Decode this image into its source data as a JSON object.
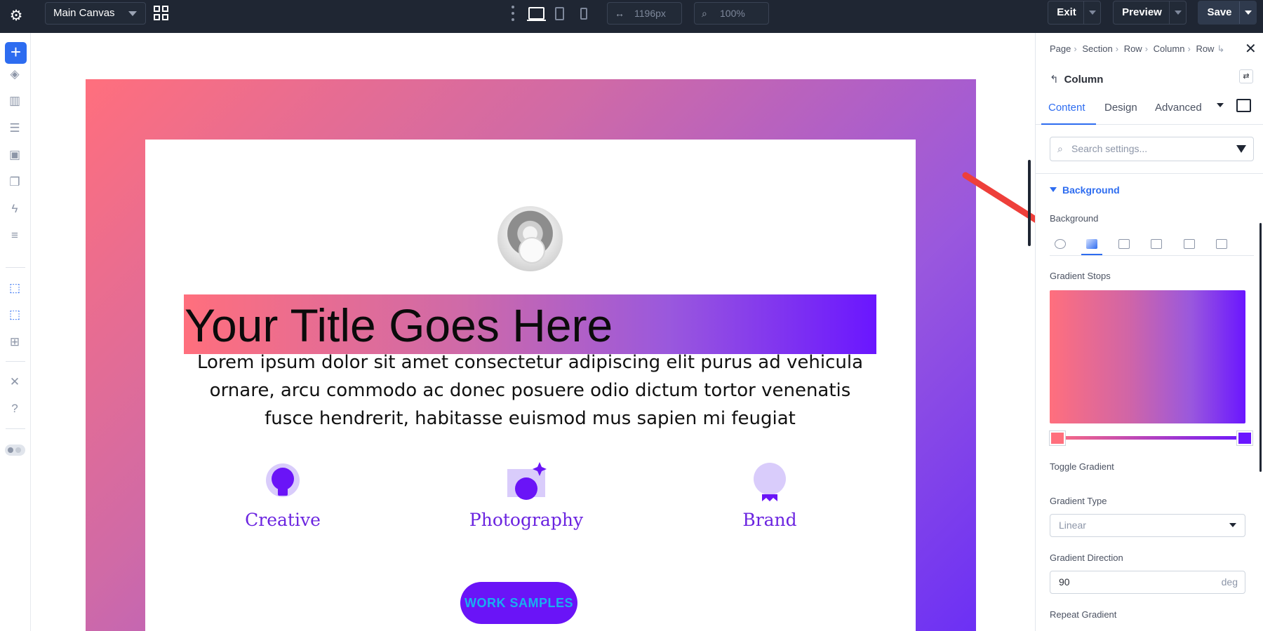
{
  "topbar": {
    "canvas_select": "Main Canvas",
    "width_value": "1196px",
    "zoom_value": "100%",
    "exit_label": "Exit",
    "preview_label": "Preview",
    "save_label": "Save"
  },
  "canvas": {
    "title": "Your Title Goes Here",
    "body": "Lorem ipsum dolor sit amet consectetur adipiscing elit purus ad vehicula ornare, arcu commodo ac donec posuere odio dictum tortor venenatis fusce hendrerit, habitasse euismod mus sapien mi feugiat",
    "features": [
      {
        "label": "Creative",
        "icon": "lightbulb-icon"
      },
      {
        "label": "Photography",
        "icon": "camera-icon"
      },
      {
        "label": "Brand",
        "icon": "badge-icon"
      }
    ],
    "button_label": "WORK SAMPLES",
    "colors": {
      "gradient_start": "#ff6f7d",
      "gradient_end": "#6a16ff",
      "accent": "#6b24e0"
    }
  },
  "panel": {
    "breadcrumb": [
      "Page",
      "Section",
      "Row",
      "Column",
      "Row"
    ],
    "title": "Column",
    "tabs": [
      "Content",
      "Design",
      "Advanced"
    ],
    "search_placeholder": "Search settings...",
    "section_title": "Background",
    "background_label": "Background",
    "gradient_stops_label": "Gradient Stops",
    "toggle_gradient_label": "Toggle Gradient",
    "gradient_type_label": "Gradient Type",
    "gradient_type_value": "Linear",
    "gradient_direction_label": "Gradient Direction",
    "gradient_direction_value": "90",
    "gradient_direction_unit": "deg",
    "repeat_gradient_label": "Repeat Gradient"
  }
}
